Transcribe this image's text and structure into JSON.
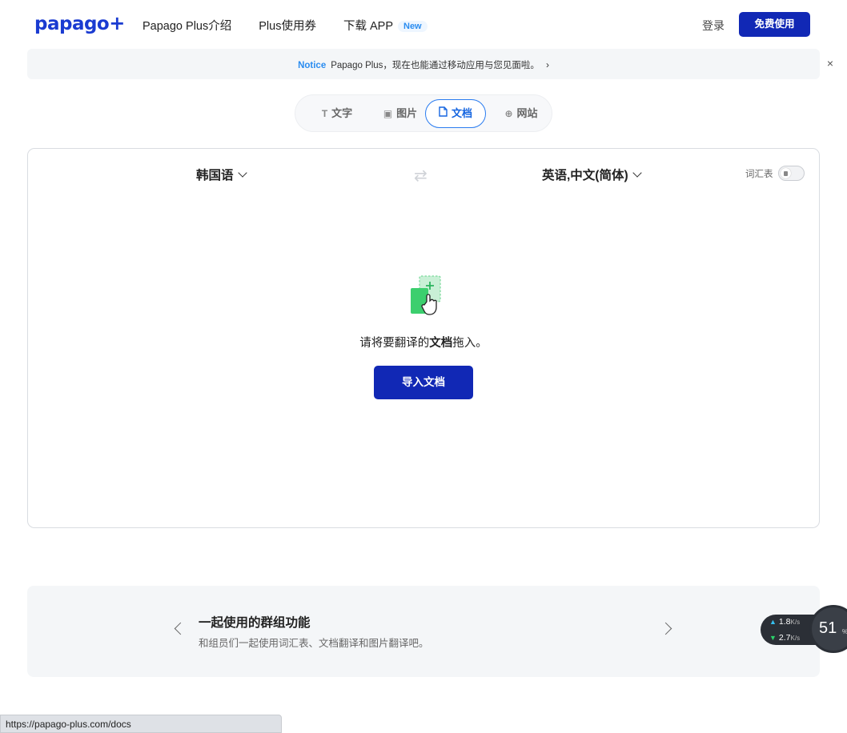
{
  "header": {
    "logo_text": "papago",
    "logo_plus": "+",
    "nav": [
      {
        "label": "Papago Plus介绍"
      },
      {
        "label": "Plus使用券"
      },
      {
        "label": "下载 APP",
        "badge": "New"
      }
    ],
    "login_label": "登录",
    "free_button_label": "免费使用"
  },
  "notice": {
    "tag": "Notice",
    "text": "Papago Plus，现在也能通过移动应用与您见面啦。",
    "chevron": "›",
    "close": "×"
  },
  "mode_tabs": [
    {
      "label": "文字",
      "icon": "text-icon",
      "glyph": "T",
      "active": false
    },
    {
      "label": "图片",
      "icon": "image-icon",
      "glyph": "▣",
      "active": false
    },
    {
      "label": "文档",
      "icon": "document-icon",
      "glyph": "🗋",
      "active": true
    },
    {
      "label": "网站",
      "icon": "globe-icon",
      "glyph": "⊕",
      "active": false
    }
  ],
  "translator": {
    "source_lang": "韩国语",
    "target_lang": "英语,中文(简体)",
    "swap_glyph": "⇄",
    "glossary_label": "词汇表",
    "glossary_enabled": false,
    "drop_text_before": "请将要翻译的",
    "drop_text_bold": "文档",
    "drop_text_after": "拖入。",
    "import_button_label": "导入文档"
  },
  "banner": {
    "title": "一起使用的群组功能",
    "subtitle": "和组员们一起使用词汇表、文档翻译和图片翻译吧。"
  },
  "network_widget": {
    "upload_value": "1.8",
    "upload_unit": "K/s",
    "download_value": "2.7",
    "download_unit": "K/s",
    "percent": "51",
    "percent_unit": "%"
  },
  "status_bar": {
    "url": "https://papago-plus.com/docs"
  },
  "colors": {
    "brand": "#1128b5",
    "accent_blue": "#2a8cf0",
    "doc_icon_green": "#3ccf6e"
  }
}
